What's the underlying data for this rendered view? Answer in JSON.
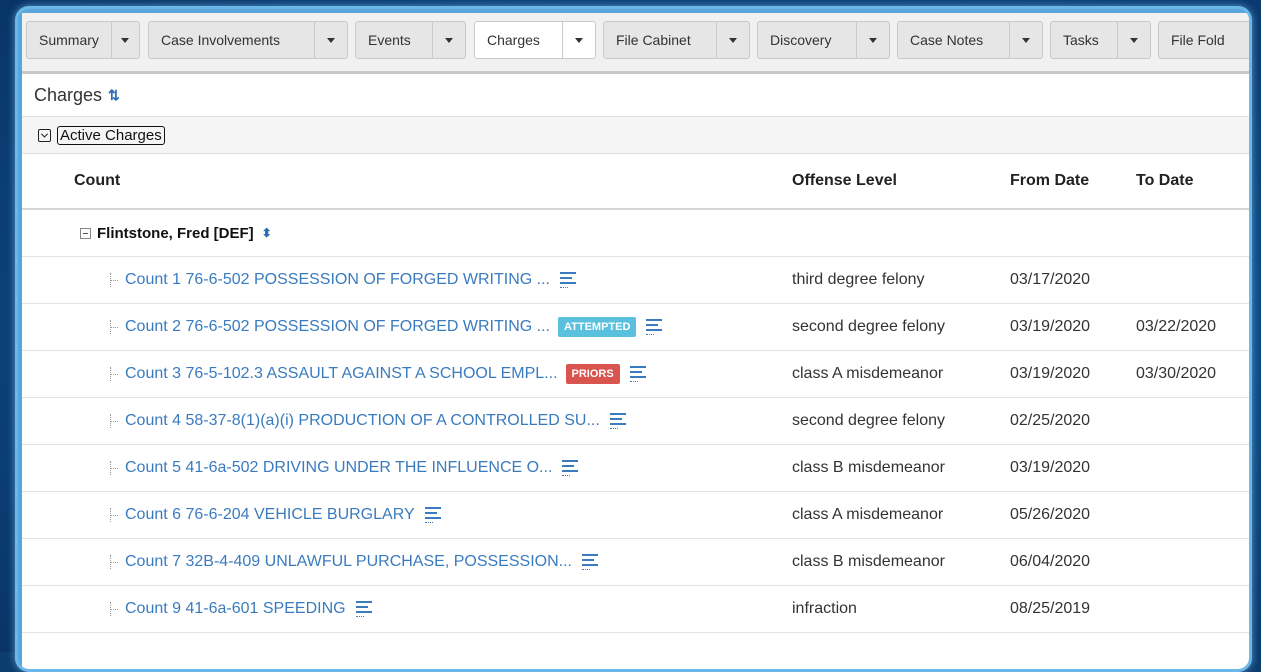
{
  "tabs": [
    {
      "label": "Summary",
      "active": false
    },
    {
      "label": "Case Involvements",
      "active": false
    },
    {
      "label": "Events",
      "active": false
    },
    {
      "label": "Charges",
      "active": true
    },
    {
      "label": "File Cabinet",
      "active": false
    },
    {
      "label": "Discovery",
      "active": false
    },
    {
      "label": "Case Notes",
      "active": false
    },
    {
      "label": "Tasks",
      "active": false
    },
    {
      "label": "File Fold",
      "active": false
    }
  ],
  "page": {
    "title": "Charges",
    "sync_icon": "sync-icon"
  },
  "section": {
    "label": "Active Charges"
  },
  "columns": {
    "count": "Count",
    "offense_level": "Offense Level",
    "from_date": "From Date",
    "to_date": "To Date"
  },
  "group": {
    "name": "Flintstone, Fred [DEF]"
  },
  "charges": [
    {
      "count": "Count 1 76-6-502 POSSESSION OF FORGED WRITING ...",
      "badge": "",
      "offense_level": "third degree felony",
      "from_date": "03/17/2020",
      "to_date": ""
    },
    {
      "count": "Count 2 76-6-502 POSSESSION OF FORGED WRITING ...",
      "badge": "ATTEMPTED",
      "offense_level": "second degree felony",
      "from_date": "03/19/2020",
      "to_date": "03/22/2020"
    },
    {
      "count": "Count 3 76-5-102.3 ASSAULT AGAINST A SCHOOL EMPL...",
      "badge": "PRIORS",
      "offense_level": "class A misdemeanor",
      "from_date": "03/19/2020",
      "to_date": "03/30/2020"
    },
    {
      "count": "Count 4 58-37-8(1)(a)(i) PRODUCTION OF A CONTROLLED SU...",
      "badge": "",
      "offense_level": "second degree felony",
      "from_date": "02/25/2020",
      "to_date": ""
    },
    {
      "count": "Count 5 41-6a-502 DRIVING UNDER THE INFLUENCE O...",
      "badge": "",
      "offense_level": "class B misdemeanor",
      "from_date": "03/19/2020",
      "to_date": ""
    },
    {
      "count": "Count 6 76-6-204 VEHICLE BURGLARY",
      "badge": "",
      "offense_level": "class A misdemeanor",
      "from_date": "05/26/2020",
      "to_date": ""
    },
    {
      "count": "Count 7 32B-4-409 UNLAWFUL PURCHASE, POSSESSION...",
      "badge": "",
      "offense_level": "class B misdemeanor",
      "from_date": "06/04/2020",
      "to_date": ""
    },
    {
      "count": "Count 9 41-6a-601 SPEEDING",
      "badge": "",
      "offense_level": "infraction",
      "from_date": "08/25/2019",
      "to_date": ""
    }
  ],
  "colors": {
    "link": "#3a7bbf",
    "attempted_badge": "#5bc0de",
    "priors_badge": "#d9534f",
    "frame_accent": "#6bb8e8"
  }
}
